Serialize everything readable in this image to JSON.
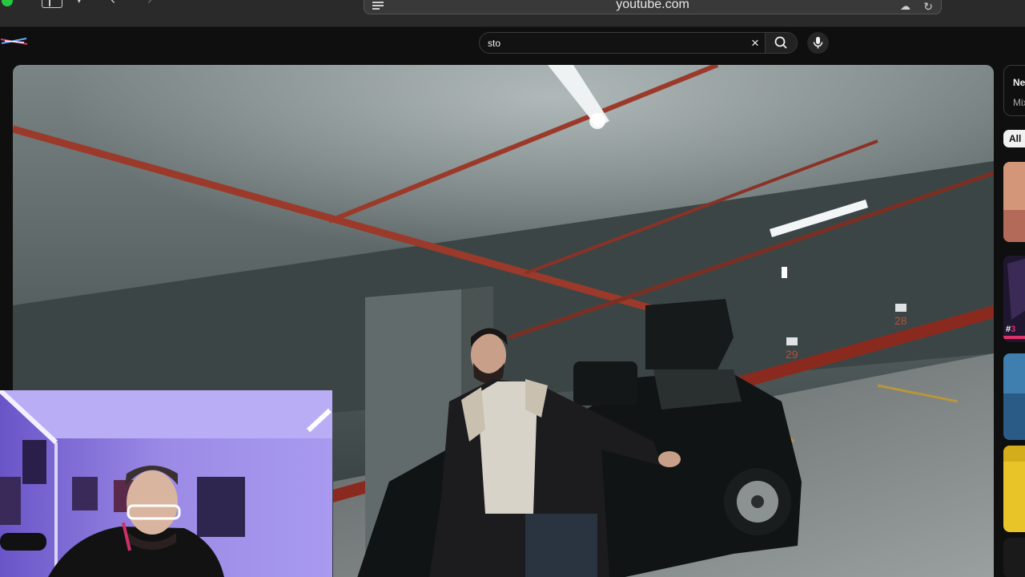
{
  "browser": {
    "url": "youtube.com"
  },
  "search": {
    "query": "sto"
  },
  "up_next": {
    "title_visible": "Ne",
    "subtitle_visible": "Mix"
  },
  "filter_chips": [
    "All"
  ],
  "thumbnails": [
    {
      "badge_prefix": "#",
      "badge_digit": "3"
    }
  ],
  "video": {
    "parking_signs": [
      "29",
      "28"
    ]
  },
  "colors": {
    "background": "#0f0f0f",
    "browser_chrome": "#2b2a2a",
    "chip_active_bg": "#f1f1f1",
    "traffic_green": "#28c840"
  }
}
